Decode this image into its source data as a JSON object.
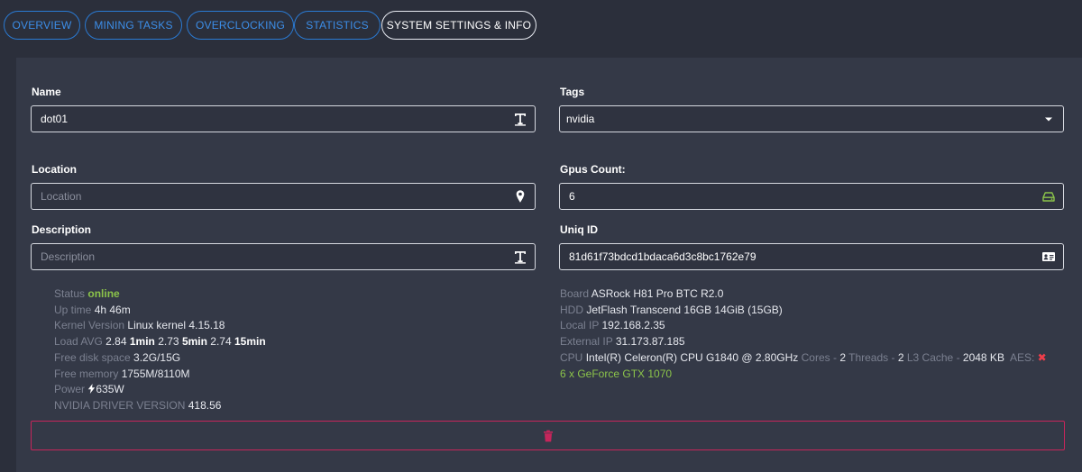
{
  "tabs": [
    "OVERVIEW",
    "MINING TASKS",
    "OVERCLOCKING",
    "STATISTICS",
    "SYSTEM SETTINGS & INFO"
  ],
  "form": {
    "name_label": "Name",
    "name_value": "dot01",
    "tags_label": "Tags",
    "tags_value": "nvidia",
    "location_label": "Location",
    "location_placeholder": "Location",
    "gpus_label": "Gpus Count:",
    "gpus_value": "6",
    "description_label": "Description",
    "description_placeholder": "Description",
    "uniq_label": "Uniq ID",
    "uniq_value": "81d61f73bdcd1bdaca6d3c8bc1762e79"
  },
  "info_left": {
    "status_key": "Status",
    "status_value": "online",
    "uptime_key": "Up time",
    "uptime_value": "4h 46m",
    "kernel_key": "Kernel Version",
    "kernel_value": "Linux kernel 4.15.18",
    "load_key": "Load AVG",
    "load_1": "2.84",
    "load_1_unit": "1min",
    "load_5": "2.73",
    "load_5_unit": "5min",
    "load_15": "2.74",
    "load_15_unit": "15min",
    "disk_key": "Free disk space",
    "disk_value": "3.2G/15G",
    "mem_key": "Free memory",
    "mem_value": "1755M/8110M",
    "power_key": "Power",
    "power_value": "635W",
    "driver_key": "NVIDIA DRIVER VERSION",
    "driver_value": "418.56"
  },
  "info_right": {
    "board_key": "Board",
    "board_value": "ASRock H81 Pro BTC R2.0",
    "hdd_key": "HDD",
    "hdd_value": "JetFlash Transcend 16GB 14GiB (15GB)",
    "localip_key": "Local IP",
    "localip_value": "192.168.2.35",
    "extip_key": "External IP",
    "extip_value": "31.173.87.185",
    "cpu_key": "CPU",
    "cpu_value": "Intel(R) Celeron(R) CPU G1840 @ 2.80GHz",
    "cores_key": "Cores -",
    "cores_value": "2",
    "threads_key": "Threads -",
    "threads_value": "2",
    "l3_key": "L3 Cache -",
    "l3_value": "2048 KB",
    "aes_key": "AES:",
    "aes_value": "✖",
    "gpu_summary": "6 x GeForce GTX 1070"
  },
  "colors": {
    "background": "#2b2f3b",
    "panel": "#343947",
    "tab_accent": "#3c8ee8",
    "online": "#8bc34a",
    "danger": "#c7255b"
  },
  "icons": {
    "name_field": "text-format-icon",
    "tags_field": "caret-down-icon",
    "location_field": "map-marker-icon",
    "gpus_field": "hdd-drive-icon",
    "description_field": "text-format-icon",
    "uniq_field": "id-card-icon",
    "power": "bolt-icon",
    "delete": "trash-icon"
  }
}
